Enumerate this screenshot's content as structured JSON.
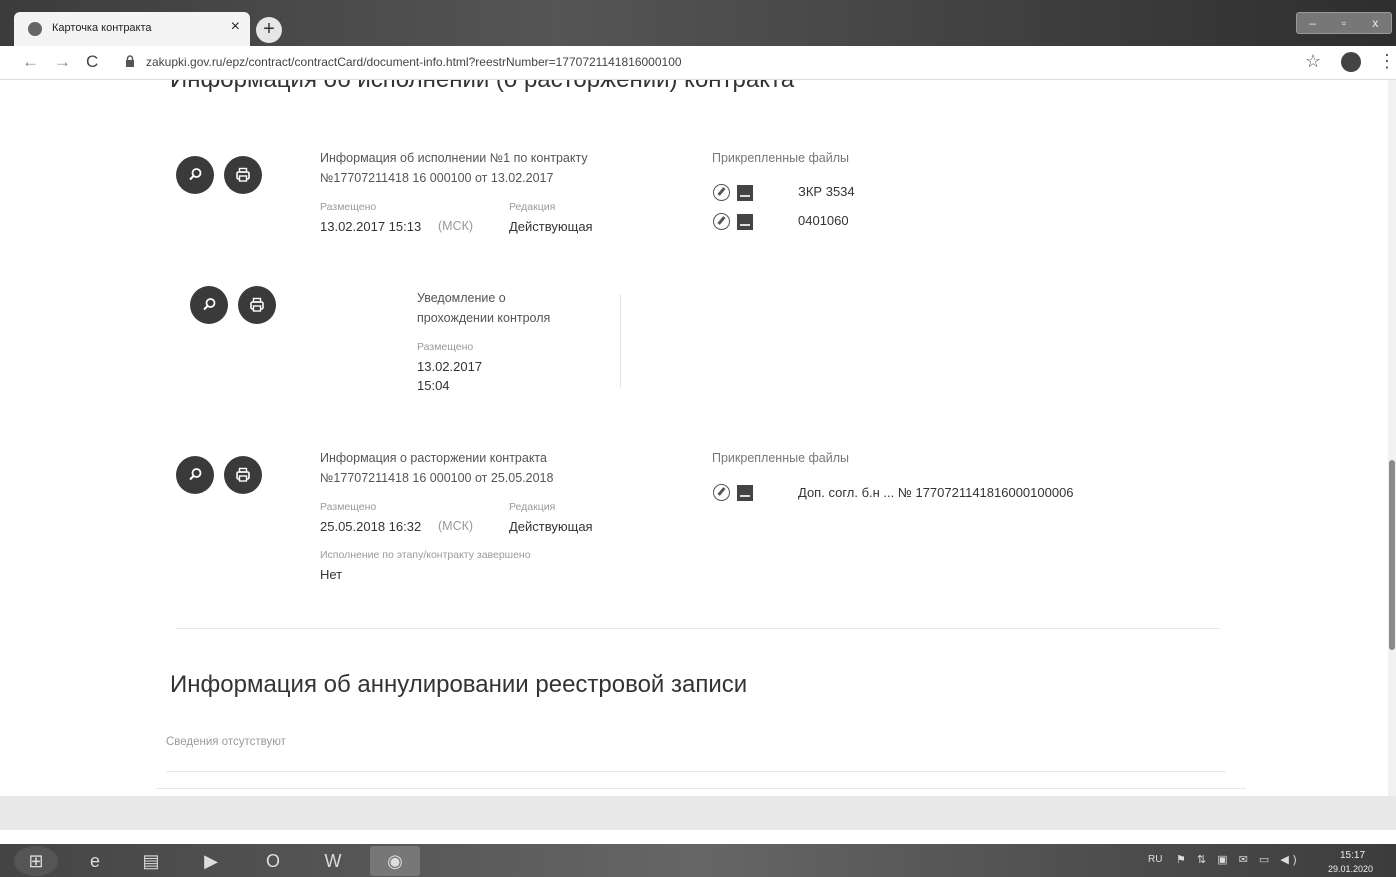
{
  "browser": {
    "tab_title": "Карточка контракта",
    "tab_close": "×",
    "new_tab": "+",
    "url": "zakupki.gov.ru/epz/contract/contractCard/document-info.html?reestrNumber=1770721141816000100",
    "window_controls": [
      "–",
      "▫",
      "x"
    ],
    "icons": [
      "back-arrow-icon",
      "forward-arrow-icon",
      "reload-icon",
      "lock-icon",
      "star-icon",
      "account-icon",
      "menu-icon"
    ]
  },
  "section_top_title": "Информация об исполнении (о расторжении) контракта",
  "records": [
    {
      "title_line1": "Информация об исполнении №1 по контракту",
      "title_line2": "№17707211418 16 000100 от 13.02.2017",
      "posted_label": "Размещено",
      "posted_value": "13.02.2017 15:13",
      "msk": "(МСК)",
      "edition_label": "Редакция",
      "edition_value": "Действующая",
      "files_title": "Прикрепленные файлы",
      "files": [
        "ЗКР 3534",
        "0401060"
      ]
    },
    {
      "title_line1": "Уведомление о",
      "title_line2": "прохождении контроля",
      "posted_label": "Размещено",
      "posted_value_line1": "13.02.2017",
      "posted_value_line2": "15:04"
    },
    {
      "title_line1": "Информация о расторжении контракта",
      "title_line2": "№17707211418 16 000100 от 25.05.2018",
      "posted_label": "Размещено",
      "posted_value": "25.05.2018 16:32",
      "msk": "(МСК)",
      "edition_label": "Редакция",
      "edition_value": "Действующая",
      "completed_label": "Исполнение по этапу/контракту завершено",
      "completed_value": "Нет",
      "files_title": "Прикрепленные файлы",
      "files": [
        "Доп. согл. б.н ... № 1770721141816000100006"
      ]
    }
  ],
  "annulment": {
    "title": "Информация об аннулировании реестровой записи",
    "empty_text": "Сведения отсутствуют"
  },
  "taskbar": {
    "lang": "RU",
    "time": "15:17",
    "date": "29.01.2020",
    "apps": [
      "windows-start-icon",
      "internet-explorer-icon",
      "file-explorer-icon",
      "media-player-icon",
      "outlook-icon",
      "word-icon",
      "chrome-icon"
    ]
  },
  "colors": {
    "button_dark": "#3a3a3a",
    "muted_text": "#9a9a9a",
    "body_text": "#333333"
  }
}
